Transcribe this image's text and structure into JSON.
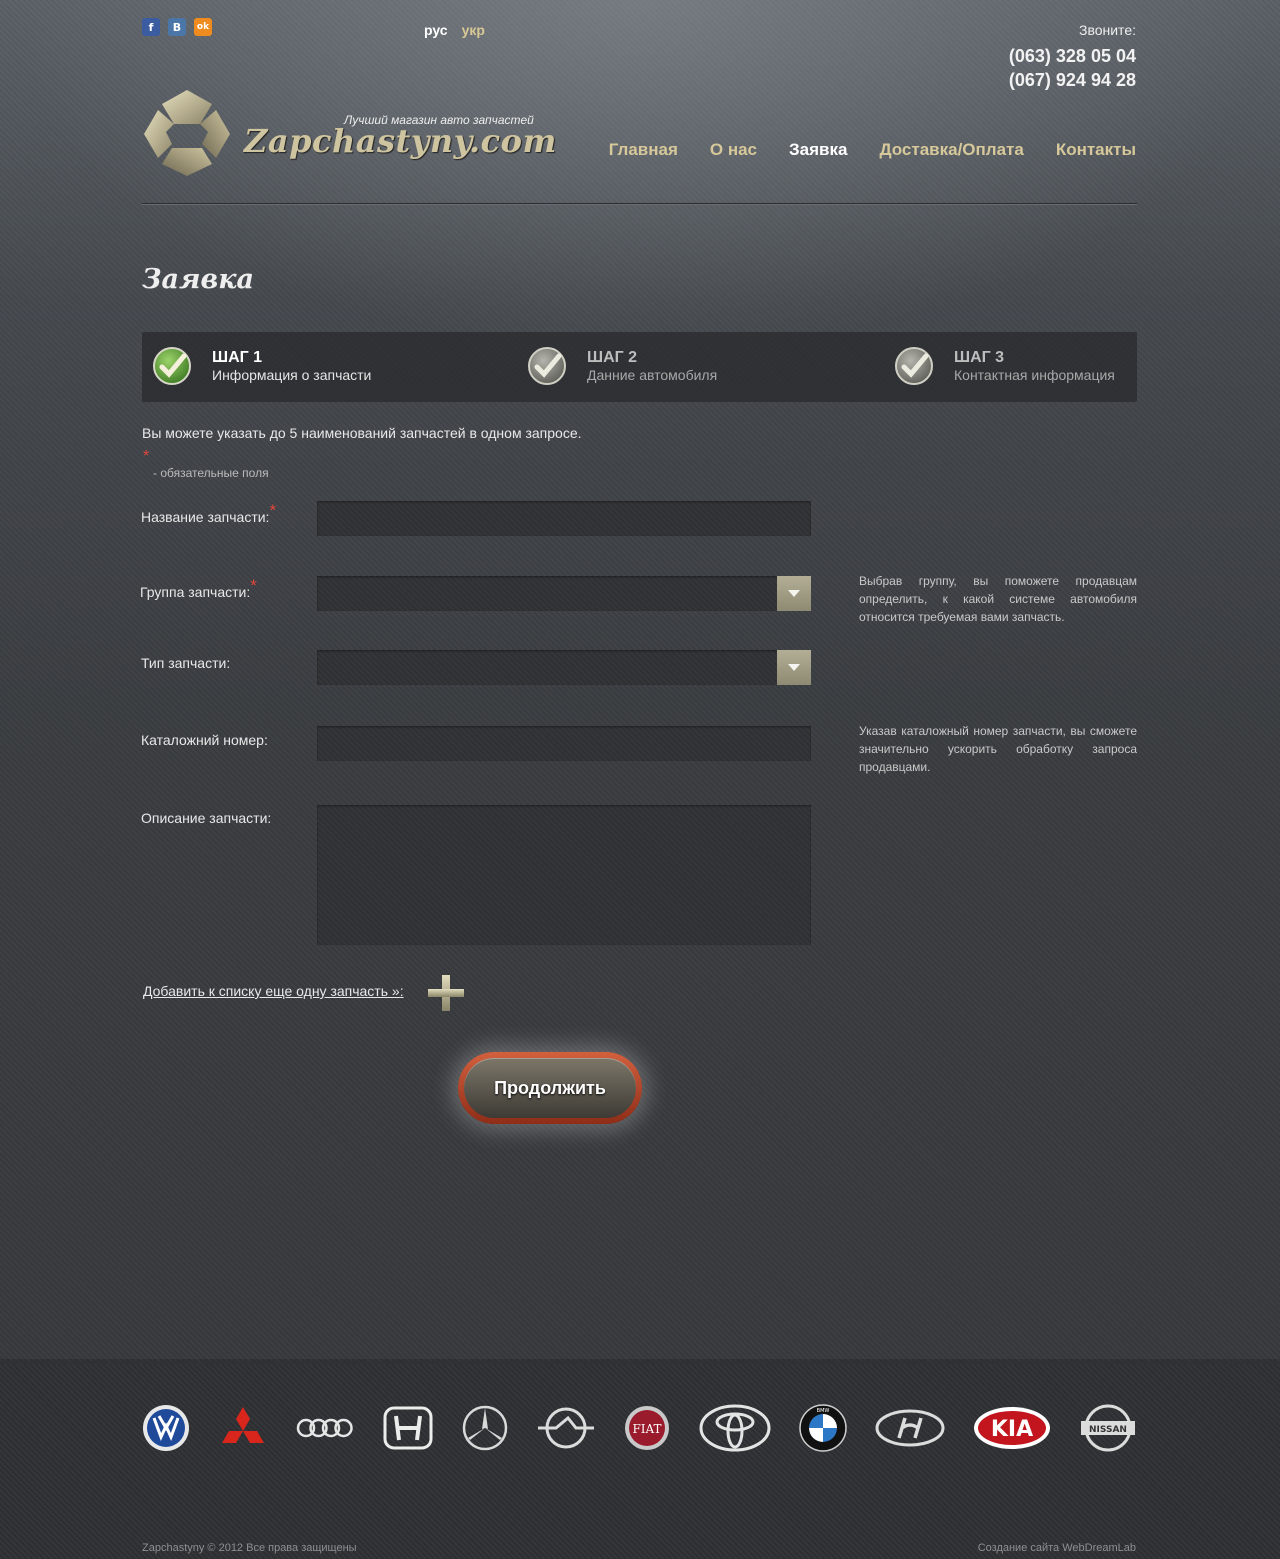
{
  "header": {
    "social": [
      {
        "name": "facebook",
        "glyph": "f",
        "color": "#3b5ca0"
      },
      {
        "name": "vkontakte",
        "glyph": "B",
        "color": "#4a76a8"
      },
      {
        "name": "odnoklassniki",
        "glyph": "ok",
        "color": "#f08c1f"
      }
    ],
    "lang_active": "рус",
    "lang_other": "укр",
    "call_label": "Звоните:",
    "phone1": "(063) 328 05 04",
    "phone2": "(067) 924 94 28",
    "tagline": "Лучший магазин авто запчастей",
    "brand": "Zapchastyny.com",
    "nav": {
      "home": "Главная",
      "about": "О нас",
      "order": "Заявка",
      "delivery": "Доставка/Оплата",
      "contacts": "Контакты"
    }
  },
  "page_title": "Заявка",
  "steps": [
    {
      "title": "ШАГ 1",
      "subtitle": "Информация о запчасти"
    },
    {
      "title": "ШАГ 2",
      "subtitle": "Данние автомобиля"
    },
    {
      "title": "ШАГ 3",
      "subtitle": "Контактная информация"
    }
  ],
  "intro": "Вы можете указать до 5 наименований запчастей в одном запросе.",
  "required_note": "- обязательные поля",
  "form": {
    "part_name_label": "Название запчасти:",
    "part_group_label": "Группа запчасти:",
    "part_type_label": "Тип запчасти:",
    "catalog_label": "Каталожний номер:",
    "description_label": "Описание запчасти:",
    "group_hint": "Выбрав группу, вы поможете продавцам определить, к какой системе автомобиля относится требуемая вами запчасть.",
    "catalog_hint": "Указав каталожный номер запчасти, вы сможете значительно ускорить обработку запроса продавцами.",
    "add_link": "Добавить к списку еще одну запчасть »:",
    "continue_button": "Продолжить"
  },
  "footer": {
    "brands": [
      "volkswagen-logo",
      "mitsubishi-logo",
      "audi-logo",
      "honda-logo",
      "mercedes-logo",
      "opel-logo",
      "fiat-logo",
      "toyota-logo",
      "bmw-logo",
      "hyundai-logo",
      "kia-logo",
      "nissan-logo"
    ],
    "fiat_text": "FIAT",
    "kia_text": "KIA",
    "nissan_text": "NISSAN",
    "bmw_text": "BMW",
    "copyright": "Zapchastyny © 2012 Все права защищены",
    "credits": "Создание сайта  WebDreamLab"
  }
}
